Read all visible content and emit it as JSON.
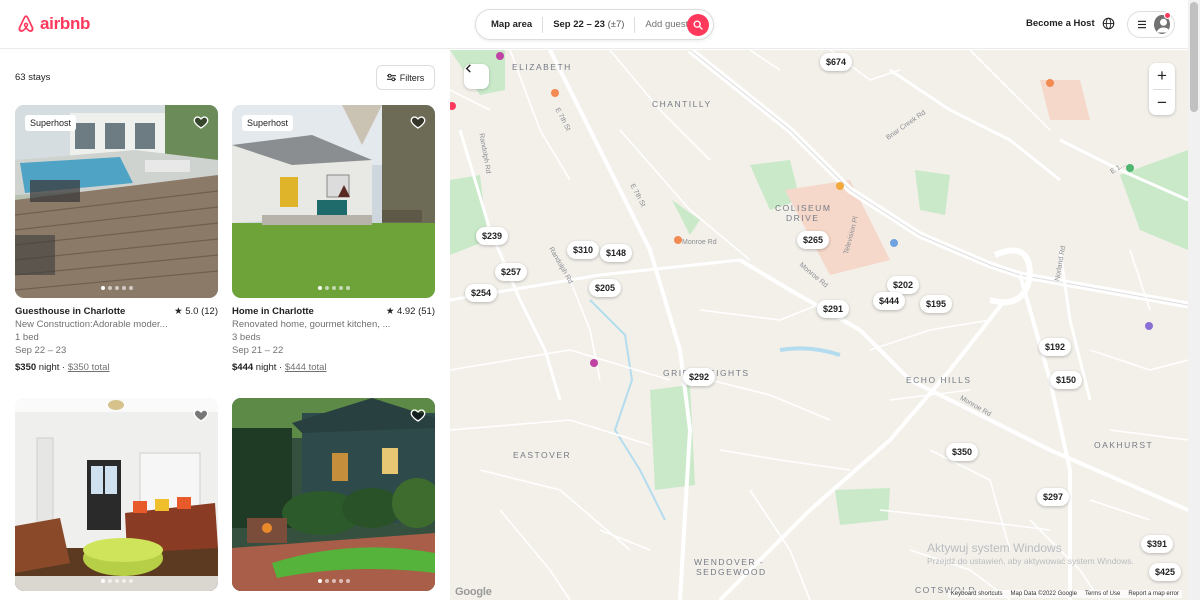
{
  "header": {
    "brand": "airbnb",
    "search": {
      "location": "Map area",
      "dates": "Sep 22 – 23",
      "flex": "(±7)",
      "guests": "Add guests"
    },
    "become_host": "Become a Host",
    "icons": [
      "airbnb-logo-icon",
      "search-icon",
      "globe-icon",
      "menu-icon",
      "user-avatar-icon"
    ],
    "accent": "#ff385c"
  },
  "list": {
    "count": "63 stays",
    "filters_label": "Filters",
    "listings": [
      {
        "badge": "Superhost",
        "title": "Guesthouse in Charlotte",
        "rating": "★ 5.0 (12)",
        "description": "New Construction:Adorable moder...",
        "beds": "1 bed",
        "dates": "Sep 22 – 23",
        "price": "$350",
        "price_unit": " night · ",
        "total": "$350 total"
      },
      {
        "badge": "Superhost",
        "title": "Home in Charlotte",
        "rating": "★ 4.92 (51)",
        "description": "Renovated home, gourmet kitchen, ...",
        "beds": "3 beds",
        "dates": "Sep 21 – 22",
        "price": "$444",
        "price_unit": " night · ",
        "total": "$444 total"
      }
    ]
  },
  "map": {
    "labels": {
      "elizabeth": "ELIZABETH",
      "chantilly": "CHANTILLY",
      "coliseum": "COLISEUM",
      "drive": "DRIVE",
      "grier": "GRIER HEIGHTS",
      "echo": "ECHO HILLS",
      "eastover": "EASTOVER",
      "oakhurst": "OAKHURST",
      "wendover": "WENDOVER -",
      "sedgewood": "SEDGEWOOD",
      "cotswold": "COTSWOLD"
    },
    "streets": {
      "e7th": "E 7th St",
      "e7th2": "E 7th St",
      "randolph1": "Randolph Rd",
      "randolph2": "Randolph Rd",
      "monroe1": "Monroe Rd",
      "monroe2": "Monroe Rd",
      "monroe3": "Monroe Rd",
      "briar": "Briar Creek Rd",
      "television": "Television Pl",
      "norland": "Norland Rd",
      "e10": "E 1..."
    },
    "prices": [
      "$674",
      "$239",
      "$310",
      "$148",
      "$257",
      "$254",
      "$205",
      "$265",
      "$202",
      "$444",
      "$195",
      "$291",
      "$192",
      "$150",
      "$292",
      "$350",
      "$297",
      "$391",
      "$425"
    ],
    "zoom_in": "+",
    "zoom_out": "−",
    "attribution": "Google",
    "footer": [
      "Keyboard shortcuts",
      "Map Data ©2022 Google",
      "Terms of Use",
      "Report a map error"
    ],
    "watermark_title": "Aktywuj system Windows",
    "watermark_sub": "Przejdź do ustawień, aby aktywować system Windows."
  }
}
